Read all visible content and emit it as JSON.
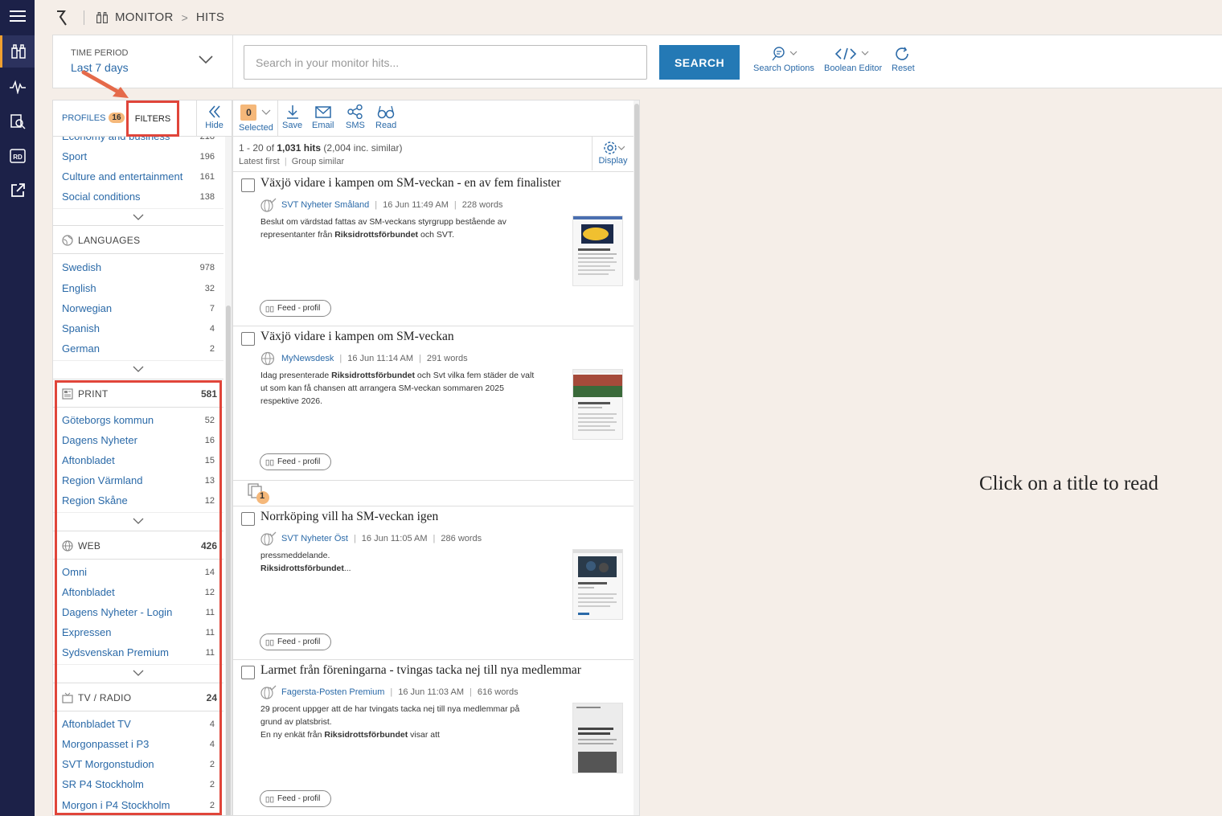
{
  "breadcrumb": {
    "monitor": "MONITOR",
    "hits": "HITS"
  },
  "search": {
    "time_period_label": "TIME PERIOD",
    "time_period_value": "Last 7 days",
    "placeholder": "Search in your monitor hits...",
    "button": "SEARCH",
    "tools": {
      "search_options": "Search Options",
      "boolean_editor": "Boolean Editor",
      "reset": "Reset"
    }
  },
  "filters": {
    "tabs": {
      "profiles": "PROFILES",
      "profiles_count": "16",
      "filters": "FILTERS",
      "hide": "Hide"
    },
    "topics": [
      {
        "label": "Economy and business",
        "count": "218"
      },
      {
        "label": "Sport",
        "count": "196"
      },
      {
        "label": "Culture and entertainment",
        "count": "161"
      },
      {
        "label": "Social conditions",
        "count": "138"
      }
    ],
    "languages_title": "LANGUAGES",
    "languages": [
      {
        "label": "Swedish",
        "count": "978"
      },
      {
        "label": "English",
        "count": "32"
      },
      {
        "label": "Norwegian",
        "count": "7"
      },
      {
        "label": "Spanish",
        "count": "4"
      },
      {
        "label": "German",
        "count": "2"
      }
    ],
    "print": {
      "title": "PRINT",
      "count": "581",
      "items": [
        {
          "label": "Göteborgs kommun",
          "count": "52"
        },
        {
          "label": "Dagens Nyheter",
          "count": "16"
        },
        {
          "label": "Aftonbladet",
          "count": "15"
        },
        {
          "label": "Region Värmland",
          "count": "13"
        },
        {
          "label": "Region Skåne",
          "count": "12"
        }
      ]
    },
    "web": {
      "title": "WEB",
      "count": "426",
      "items": [
        {
          "label": "Omni",
          "count": "14"
        },
        {
          "label": "Aftonbladet",
          "count": "12"
        },
        {
          "label": "Dagens Nyheter - Login",
          "count": "11"
        },
        {
          "label": "Expressen",
          "count": "11"
        },
        {
          "label": "Sydsvenskan Premium",
          "count": "11"
        }
      ]
    },
    "tvradio": {
      "title": "TV / RADIO",
      "count": "24",
      "items": [
        {
          "label": "Aftonbladet TV",
          "count": "4"
        },
        {
          "label": "Morgonpasset i P3",
          "count": "4"
        },
        {
          "label": "SVT Morgonstudion",
          "count": "2"
        },
        {
          "label": "SR P4 Stockholm",
          "count": "2"
        },
        {
          "label": "Morgon i P4 Stockholm",
          "count": "2"
        }
      ]
    }
  },
  "hits": {
    "toolbar": {
      "selected_count": "0",
      "selected": "Selected",
      "save": "Save",
      "email": "Email",
      "sms": "SMS",
      "read": "Read",
      "display": "Display"
    },
    "summary": {
      "range": "1 - 20 of",
      "total": "1,031 hits",
      "similar": "(2,004 inc. similar)"
    },
    "sort": {
      "latest": "Latest first",
      "group": "Group similar"
    },
    "group_count": "1",
    "items": [
      {
        "title": "Växjö vidare i kampen om SM-veckan - en av fem finalister",
        "source": "SVT Nyheter Småland",
        "date": "16 Jun 11:49 AM",
        "words": "228 words",
        "snippet_a": "Beslut om värdstad fattas av SM-veckans styrgrupp bestående av representanter från ",
        "snippet_b": "Riksidrottsförbundet",
        "snippet_c": " och SVT.",
        "tag": "Feed - profil"
      },
      {
        "title": "Växjö vidare i kampen om SM-veckan",
        "source": "MyNewsdesk",
        "date": "16 Jun 11:14 AM",
        "words": "291 words",
        "snippet_a": "Idag presenterade ",
        "snippet_b": "Riksidrottsförbundet",
        "snippet_c": " och Svt vilka fem städer de valt ut som kan få chansen att arrangera SM-veckan sommaren 2025 respektive 2026.",
        "tag": "Feed - profil"
      },
      {
        "title": "Norrköping vill ha SM-veckan igen",
        "source": "SVT Nyheter Öst",
        "date": "16 Jun 11:05 AM",
        "words": "286 words",
        "snippet_a": "pressmeddelande.",
        "snippet_b": "Riksidrottsförbundet",
        "snippet_c": "...",
        "tag": "Feed - profil"
      },
      {
        "title": "Larmet från föreningarna - tvingas tacka nej till nya medlemmar",
        "source": "Fagersta-Posten Premium",
        "date": "16 Jun 11:03 AM",
        "words": "616 words",
        "snippet_a": "29 procent uppger att de har tvingats tacka nej till nya medlemmar på grund av platsbrist.",
        "snippet_b": "Riksidrottsförbundet",
        "snippet_c": " visar att",
        "snippet_pre": "En ny enkät från ",
        "tag": "Feed - profil"
      }
    ]
  },
  "reader": {
    "message": "Click on a title to read"
  },
  "colors": {
    "rail": "#1c2148",
    "accent": "#2479b5",
    "link": "#2b6aa8",
    "badge": "#f5b87a",
    "highlight": "#e0453a",
    "background": "#f5eee8"
  }
}
